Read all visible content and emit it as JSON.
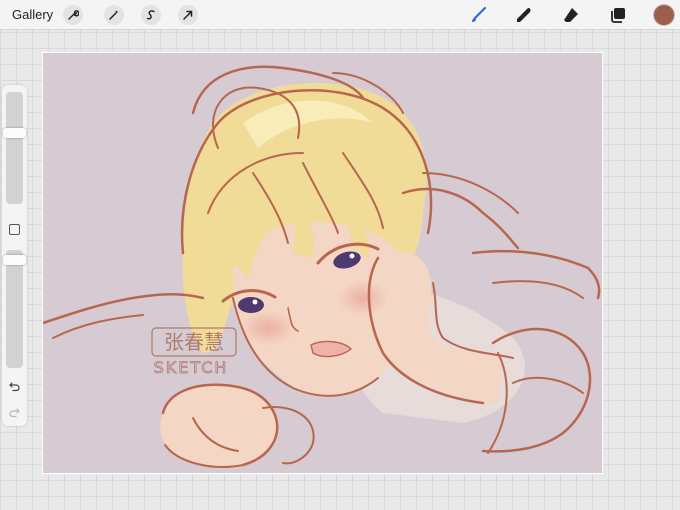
{
  "toolbar": {
    "gallery_label": "Gallery",
    "left_tools": [
      "wrench-icon",
      "magic-wand-icon",
      "selection-icon",
      "move-arrow-icon"
    ],
    "right_tools": [
      "brush-icon",
      "smudge-icon",
      "eraser-icon",
      "layers-icon"
    ],
    "current_color": "#9c5f4c",
    "active_tool_color": "#2f6bd6"
  },
  "sidebar": {
    "brush_size_level": 0.65,
    "opacity_level": 0.95,
    "icons": [
      "modify-button",
      "undo-icon",
      "redo-icon"
    ]
  },
  "canvas": {
    "background_color": "#d6cbd2",
    "sketch_color": "#b8664e",
    "hair_color": "#f0dc97",
    "skin_color": "#f4d6c4",
    "eye_color": "#4e3a6e",
    "watermark": {
      "chinese": "张春慧",
      "english": "SKETCH",
      "color": "#b07a6c"
    }
  }
}
